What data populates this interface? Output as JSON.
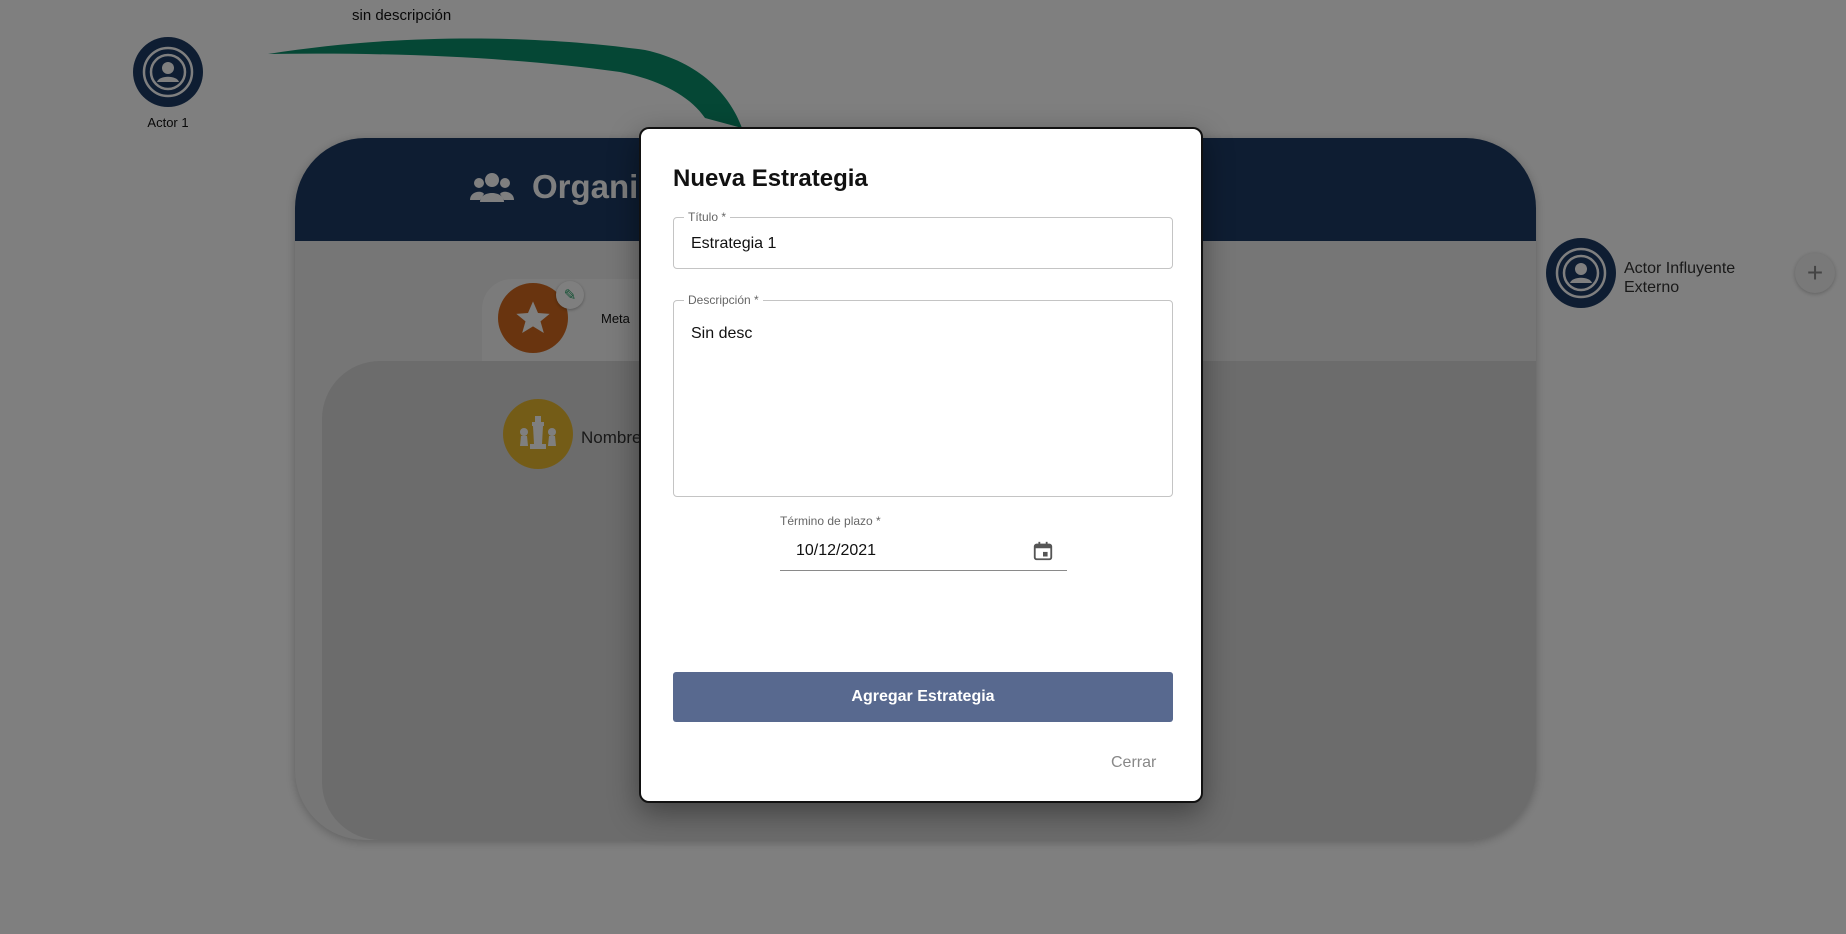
{
  "background": {
    "edge_label": "sin descripción",
    "actor": {
      "label": "Actor 1"
    },
    "organization": {
      "title_partial": "Organiz"
    },
    "goal": {
      "label": "Meta"
    },
    "strategy_node": {
      "label_partial": "Nombre"
    },
    "external_actor": {
      "label_line1": "Actor Influyente",
      "label_line2": "Externo"
    }
  },
  "dialog": {
    "title": "Nueva Estrategia",
    "titulo_field": {
      "label": "Título *",
      "value": "Estrategia 1"
    },
    "descripcion_field": {
      "label": "Descripción *",
      "value": "Sin desc"
    },
    "termino_field": {
      "label": "Término de plazo *",
      "value": "10/12/2021"
    },
    "submit_label": "Agregar Estrategia",
    "close_label": "Cerrar"
  },
  "colors": {
    "header_navy": "#1d3b64",
    "submit_button": "#58698f",
    "goal_orange": "#d2691e",
    "strategy_gold": "#e8b92f",
    "edge_green": "#0b8f6b"
  }
}
